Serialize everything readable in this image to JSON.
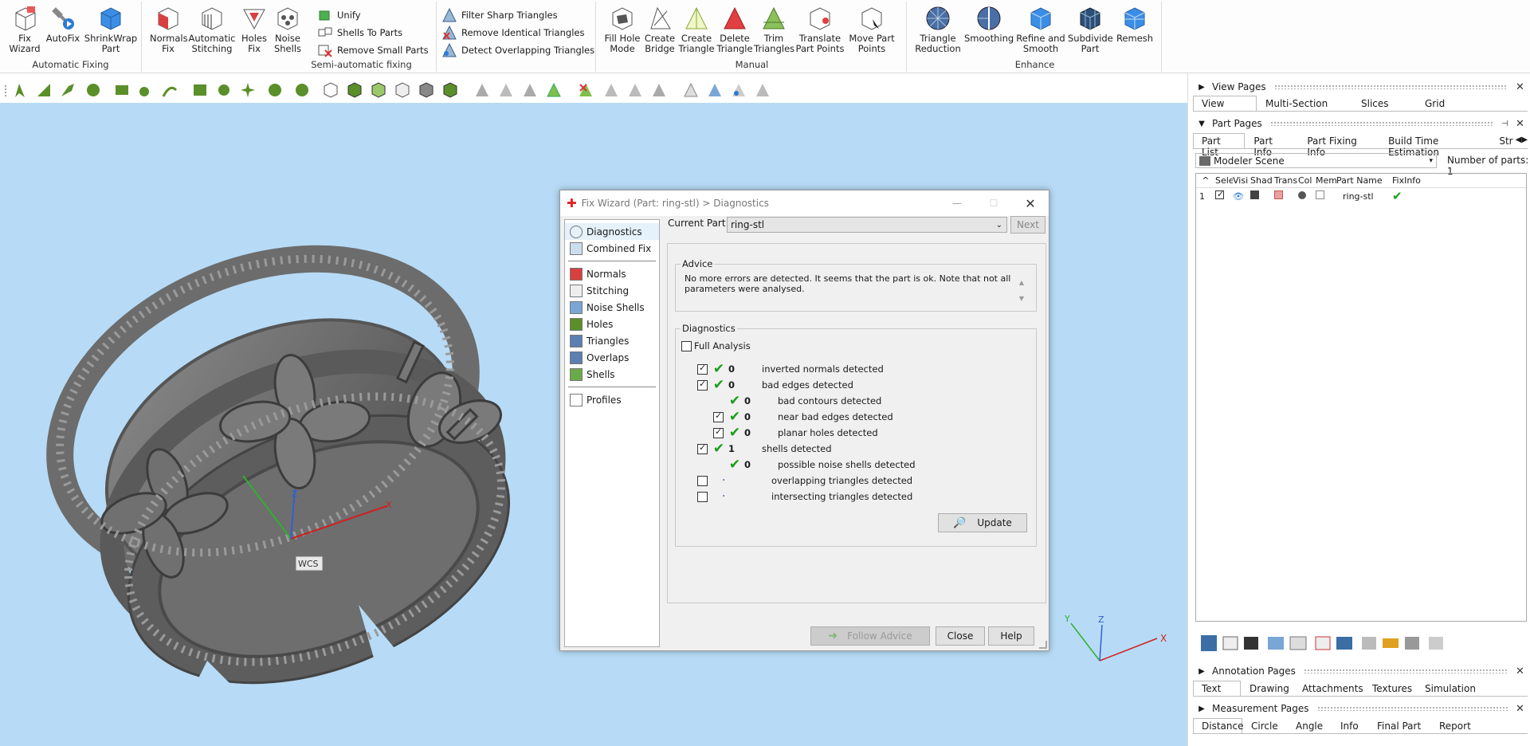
{
  "ribbon": {
    "automatic_fixing": {
      "label": "Automatic Fixing",
      "buttons": [
        {
          "l1": "Fix",
          "l2": "Wizard"
        },
        {
          "l1": "AutoFix",
          "l2": ""
        },
        {
          "l1": "ShrinkWrap",
          "l2": "Part"
        }
      ]
    },
    "semi_auto": {
      "label": "Semi-automatic fixing",
      "buttons": [
        {
          "l1": "Normals",
          "l2": "Fix"
        },
        {
          "l1": "Automatic",
          "l2": "Stitching"
        },
        {
          "l1": "Holes",
          "l2": "Fix"
        },
        {
          "l1": "Noise",
          "l2": "Shells"
        }
      ],
      "small": [
        "Unify",
        "Shells To Parts",
        "Remove Small Parts"
      ]
    },
    "triangles": {
      "small": [
        "Filter Sharp Triangles",
        "Remove Identical Triangles",
        "Detect Overlapping Triangles"
      ]
    },
    "manual": {
      "label": "Manual",
      "buttons": [
        {
          "l1": "Fill Hole",
          "l2": "Mode"
        },
        {
          "l1": "Create",
          "l2": "Bridge"
        },
        {
          "l1": "Create",
          "l2": "Triangle"
        },
        {
          "l1": "Delete",
          "l2": "Triangle"
        },
        {
          "l1": "Trim",
          "l2": "Triangles"
        },
        {
          "l1": "Translate",
          "l2": "Part Points"
        },
        {
          "l1": "Move Part",
          "l2": "Points"
        }
      ]
    },
    "enhance": {
      "label": "Enhance",
      "buttons": [
        {
          "l1": "Triangle",
          "l2": "Reduction"
        },
        {
          "l1": "Smoothing",
          "l2": ""
        },
        {
          "l1": "Refine and",
          "l2": "Smooth"
        },
        {
          "l1": "Subdivide",
          "l2": "Part"
        },
        {
          "l1": "Remesh",
          "l2": ""
        }
      ]
    }
  },
  "viewport": {
    "wcs_label": "WCS",
    "axis_x": "X",
    "axis_y": "Y",
    "axis_z": "Z"
  },
  "dialog": {
    "title": "Fix Wizard (Part: ring-stl) > Diagnostics",
    "nav_top": [
      "Diagnostics",
      "Combined Fix"
    ],
    "nav_mid": [
      "Normals",
      "Stitching",
      "Noise Shells",
      "Holes",
      "Triangles",
      "Overlaps",
      "Shells"
    ],
    "nav_bottom": [
      "Profiles"
    ],
    "current_part_label": "Current Part:",
    "current_part_value": "ring-stl",
    "next_label": "Next",
    "advice_legend": "Advice",
    "advice_text": "No more errors are detected. It seems that the part is ok. Note that not all parameters were analysed.",
    "diag_legend": "Diagnostics",
    "full_analysis": "Full Analysis",
    "rows": [
      {
        "count": "0",
        "text": "inverted normals detected"
      },
      {
        "count": "0",
        "text": "bad edges detected"
      },
      {
        "count": "0",
        "text": "bad contours detected"
      },
      {
        "count": "0",
        "text": "near bad edges detected"
      },
      {
        "count": "0",
        "text": "planar holes detected"
      },
      {
        "count": "1",
        "text": "shells detected"
      },
      {
        "count": "0",
        "text": "possible noise shells detected"
      },
      {
        "count": "",
        "text": "overlapping triangles detected"
      },
      {
        "count": "",
        "text": "intersecting triangles detected"
      }
    ],
    "update_label": "Update",
    "follow_label": "Follow Advice",
    "close_label": "Close",
    "help_label": "Help"
  },
  "right_panel": {
    "view_pages": "View Pages",
    "view_tabs": [
      "View",
      "Multi-Section",
      "Slices",
      "Grid"
    ],
    "part_pages": "Part Pages",
    "part_tabs": [
      "Part List",
      "Part Info",
      "Part Fixing Info",
      "Build Time Estimation",
      "Str"
    ],
    "scene": "Modeler Scene",
    "num_parts_label": "Number of parts:",
    "num_parts": "1",
    "columns": [
      "Sele",
      "Visi",
      "Shad",
      "Trans",
      "Col",
      "Mem",
      "Part Name",
      "FixInfo"
    ],
    "row": {
      "index": "1",
      "name": "ring-stl"
    },
    "annotation_pages": "Annotation Pages",
    "annotation_tabs": [
      "Text",
      "Drawing",
      "Attachments",
      "Textures",
      "Simulation"
    ],
    "measurement_pages": "Measurement Pages",
    "measurement_tabs": [
      "Distance",
      "Circle",
      "Angle",
      "Info",
      "Final Part",
      "Report"
    ]
  }
}
